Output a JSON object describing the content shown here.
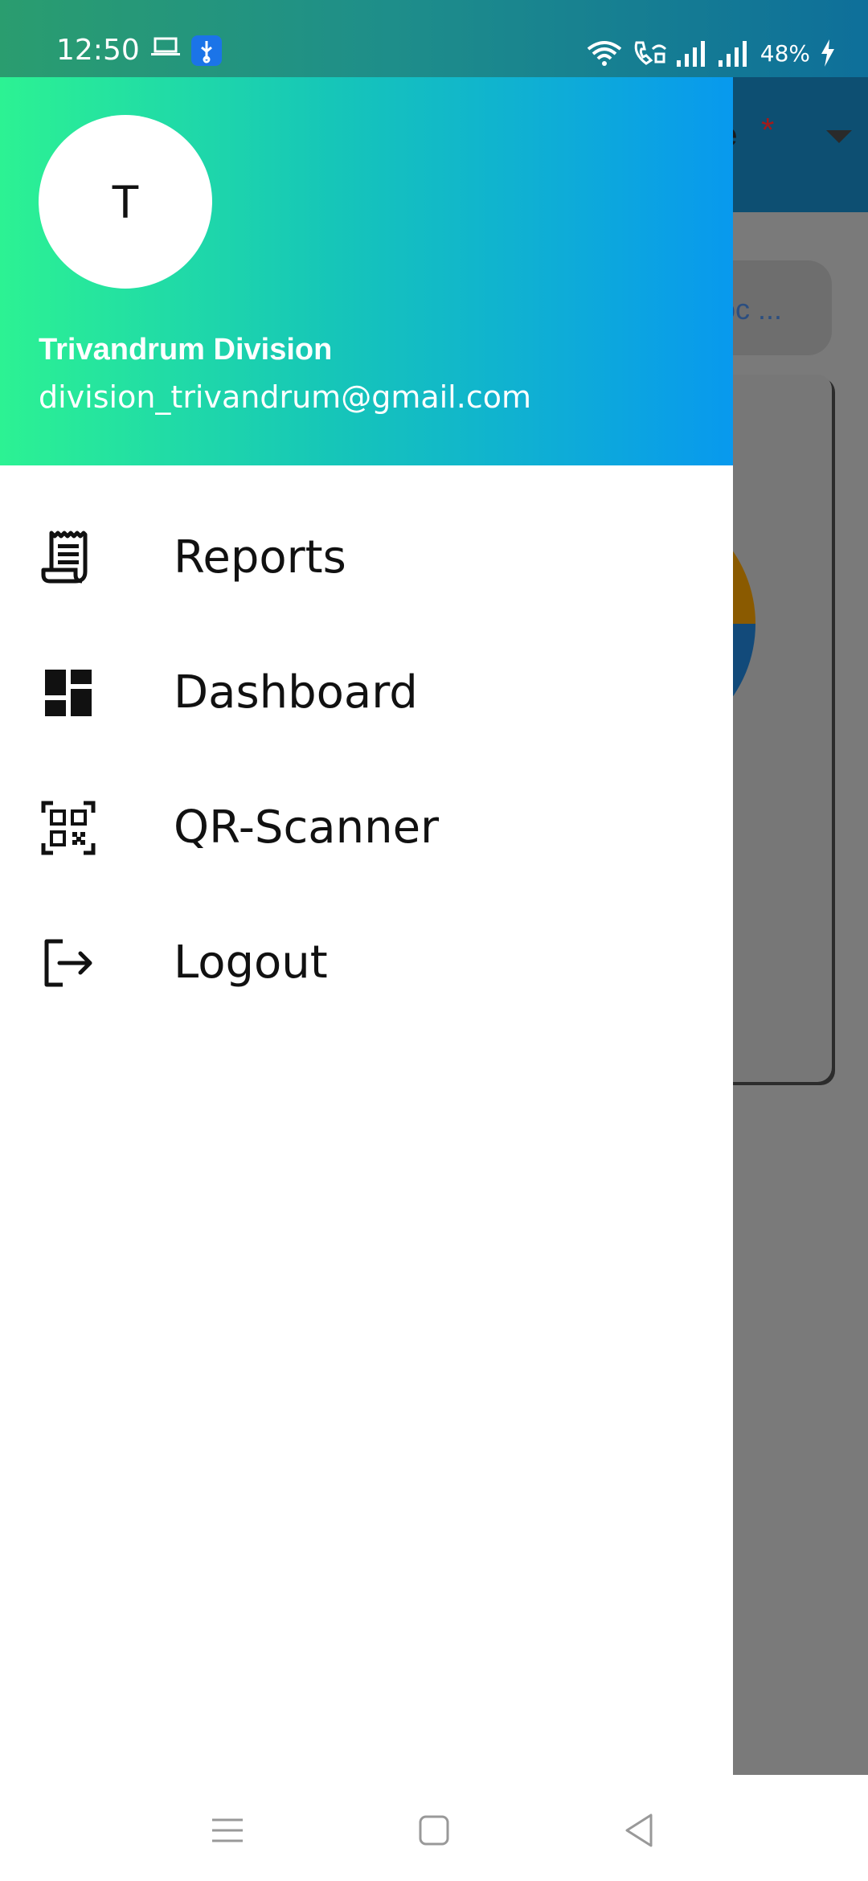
{
  "status_bar": {
    "time": "12:50",
    "battery": "48%",
    "icons": [
      "laptop-icon",
      "usb-debug-icon",
      "wifi-icon",
      "wifi-calling-icon",
      "signal-icon",
      "signal-icon",
      "charging-icon"
    ]
  },
  "background_app": {
    "title_fragment": "e",
    "required_marker": "*",
    "chip_text": "oc ..."
  },
  "drawer": {
    "avatar_initial": "T",
    "user_name": "Trivandrum Division",
    "user_email": "division_trivandrum@gmail.com",
    "items": [
      {
        "label": "Reports",
        "icon": "receipt-icon"
      },
      {
        "label": "Dashboard",
        "icon": "dashboard-icon"
      },
      {
        "label": "QR-Scanner",
        "icon": "qr-code-icon"
      },
      {
        "label": "Logout",
        "icon": "logout-icon"
      }
    ]
  },
  "nav_bar": {
    "buttons": [
      "menu-icon",
      "home-icon",
      "back-icon"
    ]
  },
  "colors": {
    "header_gradient_start": "#2cf293",
    "header_gradient_end": "#0899ee",
    "scrim": "#7a7a7a"
  }
}
